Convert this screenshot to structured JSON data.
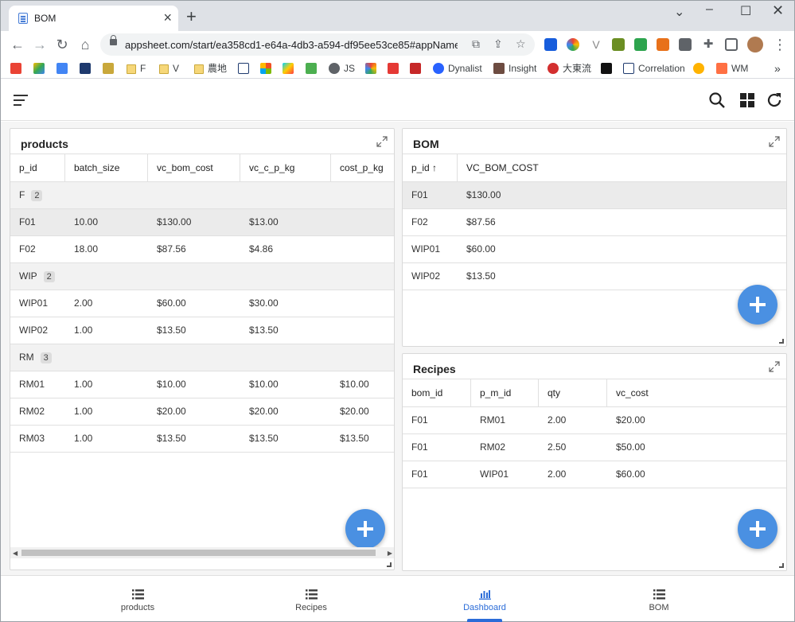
{
  "browser": {
    "tab_title": "BOM",
    "url": "appsheet.com/start/ea358cd1-e64a-4db3-a594-df95ee53ce85#appName=...",
    "bookmarks": [
      "F",
      "V",
      "農地",
      "JS",
      "Dynalist",
      "Insight",
      "大東流",
      "Correlation",
      "WM"
    ]
  },
  "products": {
    "title": "products",
    "columns": [
      "p_id",
      "batch_size",
      "vc_bom_cost",
      "vc_c_p_kg",
      "cost_p_kg"
    ],
    "groups": [
      {
        "name": "F",
        "count": "2",
        "rows": [
          [
            "F01",
            "10.00",
            "$130.00",
            "$13.00",
            ""
          ],
          [
            "F02",
            "18.00",
            "$87.56",
            "$4.86",
            ""
          ]
        ]
      },
      {
        "name": "WIP",
        "count": "2",
        "rows": [
          [
            "WIP01",
            "2.00",
            "$60.00",
            "$30.00",
            ""
          ],
          [
            "WIP02",
            "1.00",
            "$13.50",
            "$13.50",
            ""
          ]
        ]
      },
      {
        "name": "RM",
        "count": "3",
        "rows": [
          [
            "RM01",
            "1.00",
            "$10.00",
            "$10.00",
            "$10.00"
          ],
          [
            "RM02",
            "1.00",
            "$20.00",
            "$20.00",
            "$20.00"
          ],
          [
            "RM03",
            "1.00",
            "$13.50",
            "$13.50",
            "$13.50"
          ]
        ]
      }
    ]
  },
  "bom": {
    "title": "BOM",
    "columns": [
      "p_id",
      "VC_BOM_COST"
    ],
    "sort_indicator": "↑",
    "rows": [
      [
        "F01",
        "$130.00"
      ],
      [
        "F02",
        "$87.56"
      ],
      [
        "WIP01",
        "$60.00"
      ],
      [
        "WIP02",
        "$13.50"
      ]
    ]
  },
  "recipes": {
    "title": "Recipes",
    "columns": [
      "bom_id",
      "p_m_id",
      "qty",
      "vc_cost"
    ],
    "rows": [
      [
        "F01",
        "RM01",
        "2.00",
        "$20.00"
      ],
      [
        "F01",
        "RM02",
        "2.50",
        "$50.00"
      ],
      [
        "F01",
        "WIP01",
        "2.00",
        "$60.00"
      ]
    ]
  },
  "bottom_nav": [
    "products",
    "Recipes",
    "Dashboard",
    "BOM"
  ],
  "active_nav": "Dashboard",
  "colors": {
    "accent": "#4a90e2",
    "active_nav": "#2b6cd8",
    "selected_row": "#ebebeb"
  }
}
